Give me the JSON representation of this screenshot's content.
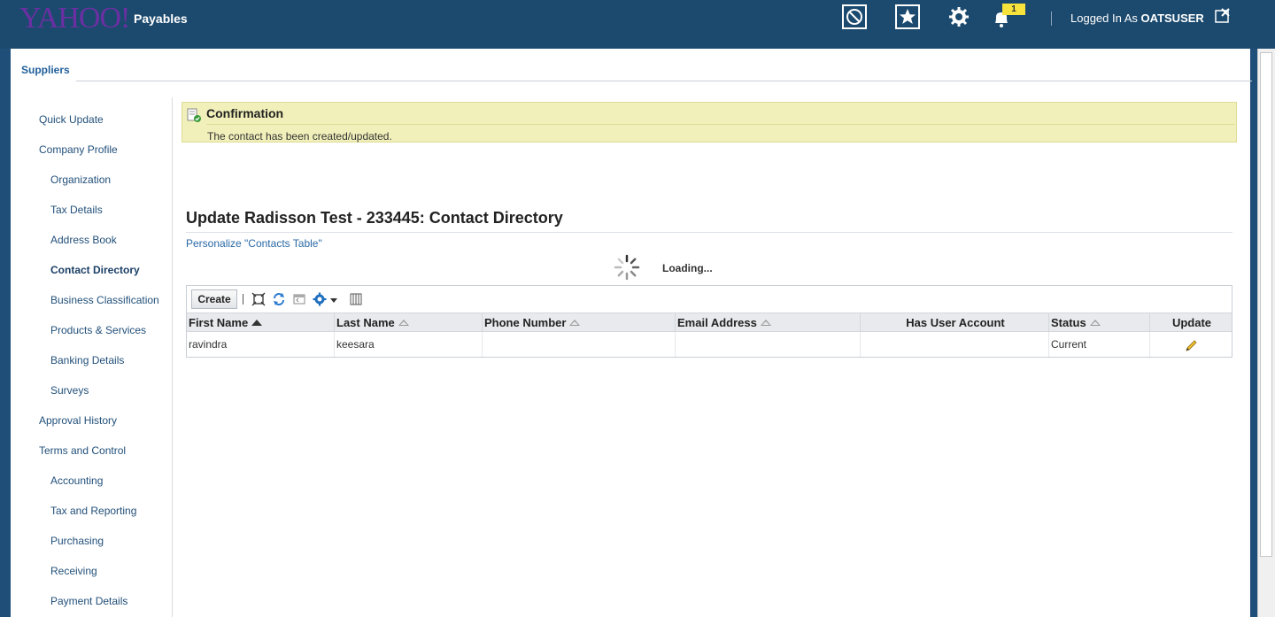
{
  "header": {
    "logo": "YAHOO!",
    "app_title": "Payables",
    "notification_count": "1",
    "logged_in_prefix": "Logged In As",
    "username": "OATSUSER"
  },
  "tabs": {
    "suppliers": "Suppliers"
  },
  "sidebar": {
    "items": [
      {
        "label": "Quick Update"
      },
      {
        "label": "Company Profile"
      },
      {
        "label": "Organization"
      },
      {
        "label": "Tax Details"
      },
      {
        "label": "Address Book"
      },
      {
        "label": "Contact Directory"
      },
      {
        "label": "Business Classification"
      },
      {
        "label": "Products & Services"
      },
      {
        "label": "Banking Details"
      },
      {
        "label": "Surveys"
      },
      {
        "label": "Approval History"
      },
      {
        "label": "Terms and Control"
      },
      {
        "label": "Accounting"
      },
      {
        "label": "Tax and Reporting"
      },
      {
        "label": "Purchasing"
      },
      {
        "label": "Receiving"
      },
      {
        "label": "Payment Details"
      }
    ]
  },
  "confirmation": {
    "title": "Confirmation",
    "message": "The contact has been created/updated."
  },
  "page": {
    "title": "Update Radisson Test - 233445: Contact Directory",
    "personalize": "Personalize \"Contacts Table\"",
    "loading": "Loading..."
  },
  "table": {
    "create_label": "Create",
    "columns": [
      "First Name",
      "Last Name",
      "Phone Number",
      "Email Address",
      "Has User Account",
      "Status",
      "Update"
    ],
    "rows": [
      {
        "first_name": "ravindra",
        "last_name": "keesara",
        "phone": "",
        "email": "",
        "has_user_account": "",
        "status": "Current"
      }
    ]
  },
  "colors": {
    "header_bg": "#1c4a6e",
    "accent_link": "#2a6aa6",
    "confirmation_bg": "#f1f0ba",
    "badge": "#f7e33b"
  }
}
